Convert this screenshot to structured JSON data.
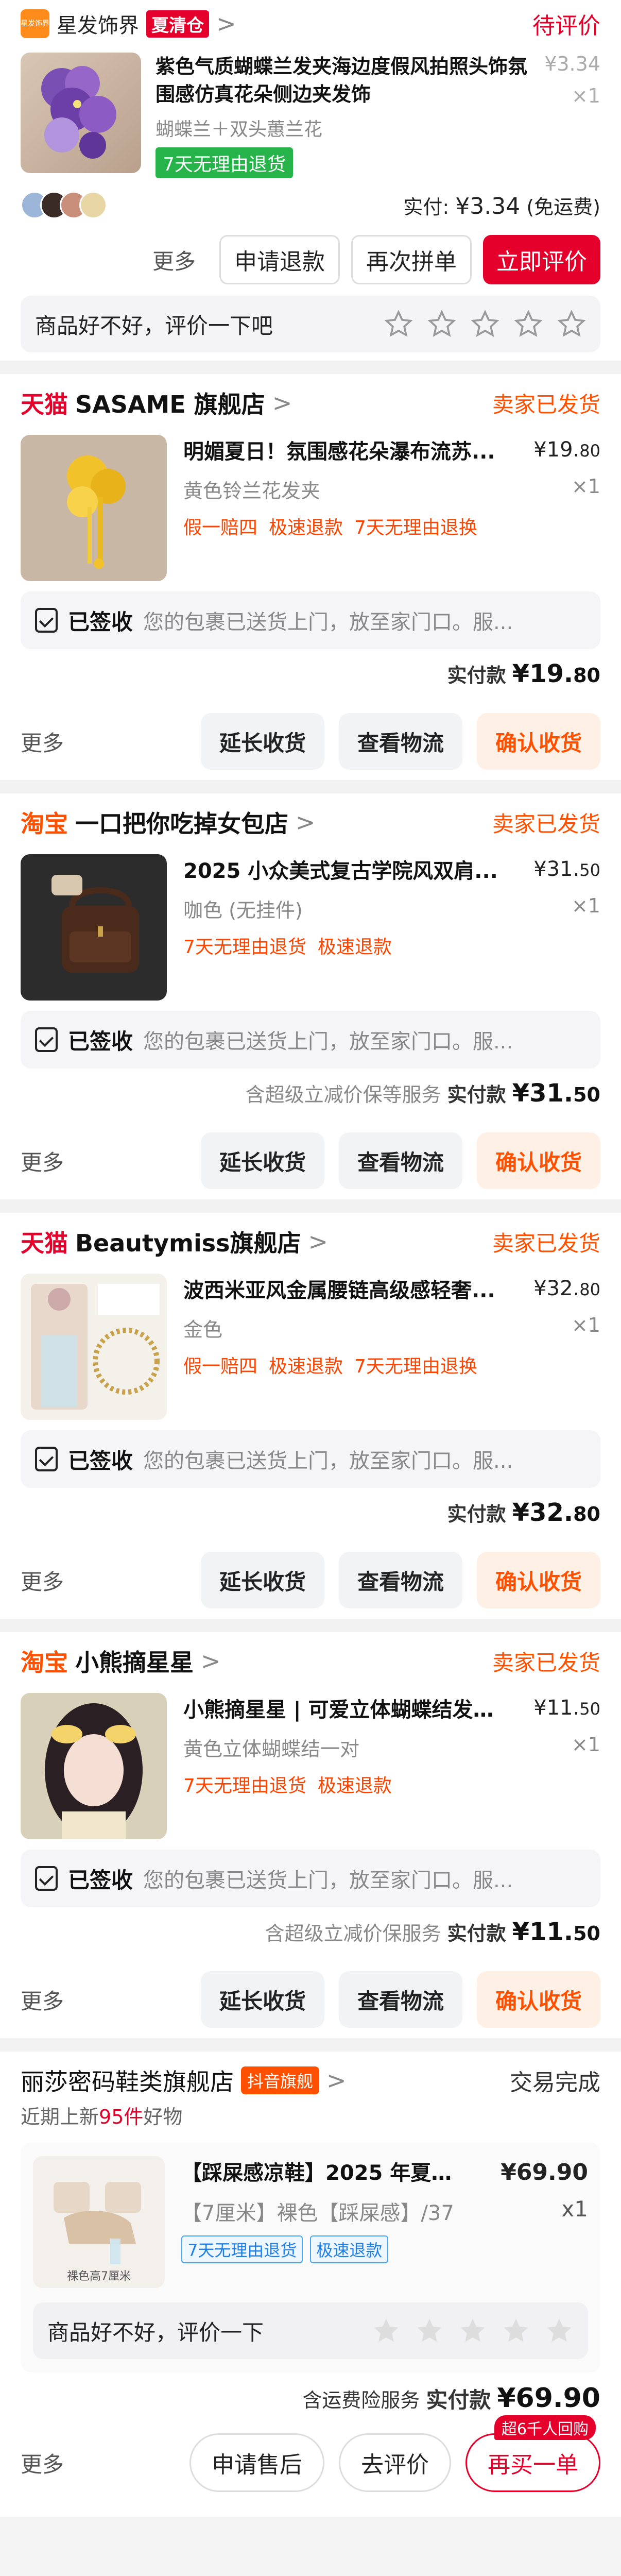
{
  "top": {
    "shop_logo_text": "星发饰界",
    "shop_name": "星发饰界",
    "clearance_tag": "夏清仓",
    "chevron": ">",
    "status": "待评价",
    "item_title": "紫色气质蝴蝶兰发夹海边度假风拍照头饰氛围感仿真花朵侧边夹发饰",
    "item_spec": "蝴蝶兰＋双头蕙兰花",
    "return_badge": "7天无理由退货",
    "price": "¥3.34",
    "qty": "×1",
    "paid_label": "实付:",
    "paid_amount": "¥3.34",
    "paid_note": "(免运费)",
    "more": "更多",
    "btn_refund": "申请退款",
    "btn_reorder": "再次拼单",
    "btn_review": "立即评价",
    "rate_prompt": "商品好不好，评价一下吧"
  },
  "orders": [
    {
      "platform": "天猫",
      "platform_type": "tmall",
      "shop": "SASAME 旗舰店",
      "status": "卖家已发货",
      "title": "明媚夏日！氛围感花朵瀑布流苏...",
      "price_int": "¥19.",
      "price_dec": "80",
      "spec": "黄色铃兰花发夹",
      "qty": "×1",
      "badges": [
        "假一赔四",
        "极速退款",
        "7天无理由退换"
      ],
      "delivery_label": "已签收",
      "delivery_text": "您的包裹已送货上门，放至家门口。服...",
      "service": "",
      "paid_label": "实付款",
      "paid_int": "¥19.",
      "paid_dec": "80",
      "more": "更多",
      "btn1": "延长收货",
      "btn2": "查看物流",
      "btn3": "确认收货"
    },
    {
      "platform": "淘宝",
      "platform_type": "taobao",
      "shop": "一口把你吃掉女包店",
      "status": "卖家已发货",
      "title": "2025 小众美式复古学院风双肩...",
      "price_int": "¥31.",
      "price_dec": "50",
      "spec": "咖色 (无挂件)",
      "qty": "×1",
      "badges": [
        "7天无理由退货",
        "极速退款"
      ],
      "delivery_label": "已签收",
      "delivery_text": "您的包裹已送货上门，放至家门口。服...",
      "service": "含超级立减价保等服务",
      "paid_label": "实付款",
      "paid_int": "¥31.",
      "paid_dec": "50",
      "more": "更多",
      "btn1": "延长收货",
      "btn2": "查看物流",
      "btn3": "确认收货"
    },
    {
      "platform": "天猫",
      "platform_type": "tmall",
      "shop": "Beautymiss旗舰店",
      "status": "卖家已发货",
      "title": "波西米亚风金属腰链高级感轻奢...",
      "price_int": "¥32.",
      "price_dec": "80",
      "spec": "金色",
      "qty": "×1",
      "badges": [
        "假一赔四",
        "极速退款",
        "7天无理由退换"
      ],
      "delivery_label": "已签收",
      "delivery_text": "您的包裹已送货上门，放至家门口。服...",
      "service": "",
      "paid_label": "实付款",
      "paid_int": "¥32.",
      "paid_dec": "80",
      "more": "更多",
      "btn1": "延长收货",
      "btn2": "查看物流",
      "btn3": "确认收货"
    },
    {
      "platform": "淘宝",
      "platform_type": "taobao",
      "shop": "小熊摘星星",
      "status": "卖家已发货",
      "title": "小熊摘星星 | 可爱立体蝴蝶结发夹...",
      "price_int": "¥11.",
      "price_dec": "50",
      "spec": "黄色立体蝴蝶结一对",
      "qty": "×1",
      "badges": [
        "7天无理由退货",
        "极速退款"
      ],
      "delivery_label": "已签收",
      "delivery_text": "您的包裹已送货上门，放至家门口。服...",
      "service": "含超级立减价保服务",
      "paid_label": "实付款",
      "paid_int": "¥11.",
      "paid_dec": "50",
      "more": "更多",
      "btn1": "延长收货",
      "btn2": "查看物流",
      "btn3": "确认收货"
    }
  ],
  "last": {
    "shop": "丽莎密码鞋类旗舰店",
    "mall_tag": "抖音旗舰",
    "status": "交易完成",
    "sub_prefix": "近期",
    "sub_mid": "上新",
    "sub_count": "95件",
    "sub_suffix": "好物",
    "thumb_caption": "裸色高7厘米",
    "title": "【踩屎感凉鞋】2025 年夏季...",
    "price": "¥69.90",
    "spec": "【7厘米】裸色【踩屎感】/37",
    "qty": "x1",
    "badge1": "7天无理由退货",
    "badge2": "极速退款",
    "rate_prompt": "商品好不好，评价一下",
    "service": "含运费险服务",
    "paid_label": "实付款",
    "paid_amount": "¥69.90",
    "more": "更多",
    "btn1": "申请售后",
    "btn2": "去评价",
    "btn3": "再买一单",
    "hot_badge": "超6千人回购"
  }
}
